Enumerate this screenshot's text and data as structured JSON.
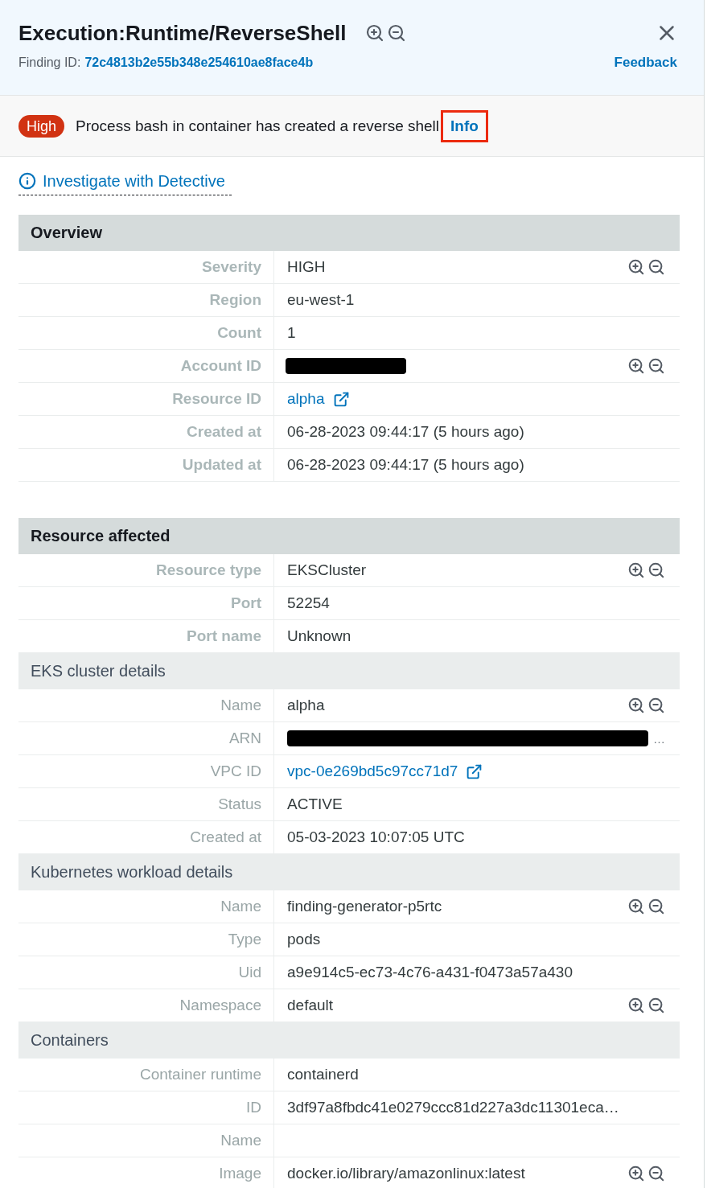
{
  "header": {
    "title": "Execution:Runtime/ReverseShell",
    "finding_id_label": "Finding ID:",
    "finding_id": "72c4813b2e55b348e254610ae8face4b",
    "feedback": "Feedback"
  },
  "summary": {
    "badge": "High",
    "description": "Process bash in container has created a reverse shell",
    "info_link": {
      "label": "Info",
      "highlighted": true
    }
  },
  "investigate_link": "Investigate with Detective",
  "sections": [
    {
      "title": "Overview",
      "groups": [
        {
          "rows": [
            {
              "label": "Severity",
              "kind": "text",
              "value": "HIGH",
              "filter_icons": true
            },
            {
              "label": "Region",
              "kind": "text",
              "value": "eu-west-1",
              "filter_icons": false
            },
            {
              "label": "Count",
              "kind": "text",
              "value": "1",
              "filter_icons": false
            },
            {
              "label": "Account ID",
              "kind": "redacted",
              "filter_icons": true
            },
            {
              "label": "Resource ID",
              "kind": "link",
              "value": "alpha",
              "filter_icons": false
            },
            {
              "label": "Created at",
              "kind": "text",
              "value": "06-28-2023 09:44:17 (5 hours ago)",
              "filter_icons": false
            },
            {
              "label": "Updated at",
              "kind": "text",
              "value": "06-28-2023 09:44:17 (5 hours ago)",
              "filter_icons": false
            }
          ]
        }
      ]
    },
    {
      "title": "Resource affected",
      "groups": [
        {
          "rows": [
            {
              "label": "Resource type",
              "kind": "text",
              "value": "EKSCluster",
              "filter_icons": true
            },
            {
              "label": "Port",
              "kind": "text",
              "value": "52254",
              "filter_icons": false
            },
            {
              "label": "Port name",
              "kind": "text",
              "value": "Unknown",
              "filter_icons": false
            }
          ]
        },
        {
          "title": "EKS cluster details",
          "rows": [
            {
              "label": "Name",
              "kind": "text",
              "value": "alpha",
              "filter_icons": true
            },
            {
              "label": "ARN",
              "kind": "redacted",
              "tail": "…",
              "filter_icons": false
            },
            {
              "label": "VPC ID",
              "kind": "link",
              "value": "vpc-0e269bd5c97cc71d7",
              "filter_icons": false
            },
            {
              "label": "Status",
              "kind": "text",
              "value": "ACTIVE",
              "filter_icons": false
            },
            {
              "label": "Created at",
              "kind": "text",
              "value": "05-03-2023 10:07:05 UTC",
              "filter_icons": false
            }
          ]
        },
        {
          "title": "Kubernetes workload details",
          "rows": [
            {
              "label": "Name",
              "kind": "text",
              "value": "finding-generator-p5rtc",
              "filter_icons": true
            },
            {
              "label": "Type",
              "kind": "text",
              "value": "pods",
              "filter_icons": false
            },
            {
              "label": "Uid",
              "kind": "text",
              "value": "a9e914c5-ec73-4c76-a431-f0473a57a430",
              "filter_icons": false
            },
            {
              "label": "Namespace",
              "kind": "text",
              "value": "default",
              "filter_icons": true
            }
          ]
        },
        {
          "title": "Containers",
          "rows": [
            {
              "label": "Container runtime",
              "kind": "text",
              "value": "containerd",
              "filter_icons": false
            },
            {
              "label": "ID",
              "kind": "text",
              "value": "3df97a8fbdc41e0279ccc81d227a3dc11301eca…",
              "filter_icons": false
            },
            {
              "label": "Name",
              "kind": "text",
              "filter_icons": false
            },
            {
              "label": "Image",
              "kind": "text",
              "value": "docker.io/library/amazonlinux:latest",
              "filter_icons": true
            }
          ]
        }
      ]
    }
  ]
}
